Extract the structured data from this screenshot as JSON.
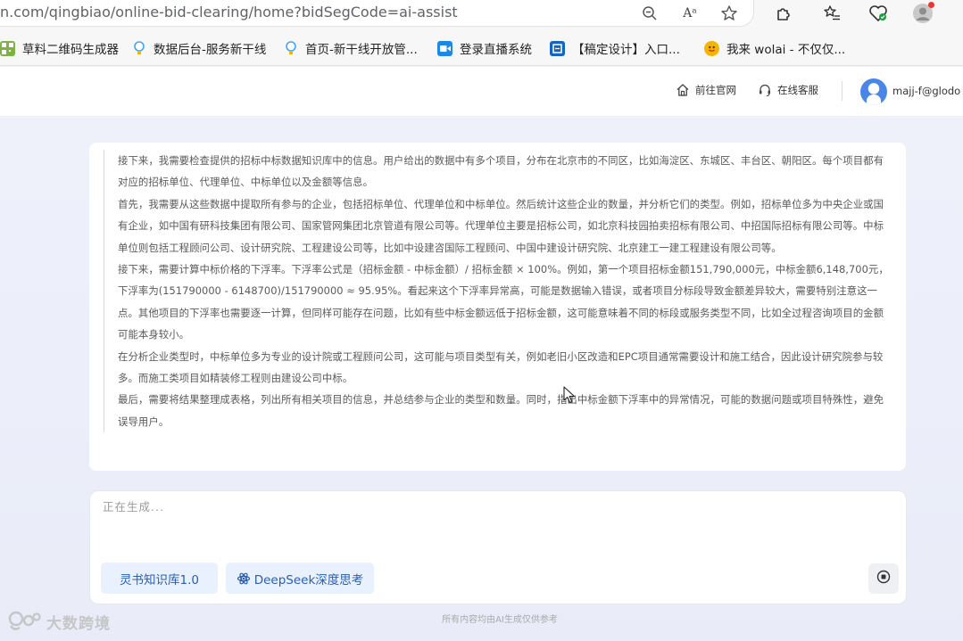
{
  "browser": {
    "url": "n.com/qingbiao/online-bid-clearing/home?bidSegCode=ai-assist",
    "reader_label": "Aᵃ",
    "bookmarks": [
      {
        "label": "草料二维码生成器",
        "icon": "qr-grid-icon",
        "color": "#7cb342"
      },
      {
        "label": "数据后台-服务新干线",
        "icon": "bulb-icon",
        "color": "#42a5f5"
      },
      {
        "label": "首页-新干线开放管...",
        "icon": "bulb-icon",
        "color": "#42a5f5"
      },
      {
        "label": "登录直播系统",
        "icon": "video-icon",
        "color": "#1e88e5"
      },
      {
        "label": "【稿定设计】入口...",
        "icon": "gaoding-icon",
        "color": "#1565c0"
      },
      {
        "label": "我来 wolai - 不仅仅...",
        "icon": "smiley-icon",
        "color": "#f4b400"
      }
    ]
  },
  "header": {
    "home_link": "前往官网",
    "service_link": "在线客服",
    "user": "majj-f@glodo"
  },
  "answer": {
    "paragraphs": [
      "接下来，我需要检查提供的招标中标数据知识库中的信息。用户给出的数据中有多个项目，分布在北京市的不同区，比如海淀区、东城区、丰台区、朝阳区。每个项目都有对应的招标单位、代理单位、中标单位以及金额等信息。",
      "首先，我需要从这些数据中提取所有参与的企业，包括招标单位、代理单位和中标单位。然后统计这些企业的数量，并分析它们的类型。例如，招标单位多为中央企业或国有企业，如中国有研科技集团有限公司、国家管网集团北京管道有限公司等。代理单位主要是招标公司，如北京科技园拍卖招标有限公司、中招国际招标有限公司等。中标单位则包括工程顾问公司、设计研究院、工程建设公司等，比如中设建咨国际工程顾问、中国中建设计研究院、北京建工一建工程建设有限公司等。",
      "接下来，需要计算中标价格的下浮率。下浮率公式是（招标金额 - 中标金额）/ 招标金额 × 100%。例如，第一个项目招标金额151,790,000元，中标金额6,148,700元，下浮率为(151790000 - 6148700)/151790000 ≈ 95.95%。看起来这个下浮率异常高，可能是数据输入错误，或者项目分标段导致金额差异较大，需要特别注意这一点。其他项目的下浮率也需要逐一计算，但同样可能存在问题，比如有些中标金额远低于招标金额，这可能意味着不同的标段或服务类型不同，比如全过程咨询项目的金额可能本身较小。",
      "在分析企业类型时，中标单位多为专业的设计院或工程顾问公司，这可能与项目类型有关，例如老旧小区改造和EPC项目通常需要设计和施工结合，因此设计研究院参与较多。而施工类项目如精装修工程则由建设公司中标。",
      "最后，需要将结果整理成表格，列出所有相关项目的信息，并总结参与企业的类型和数量。同时，指出中标金额下浮率中的异常情况，可能的数据问题或项目特殊性，避免误导用户。"
    ]
  },
  "input": {
    "placeholder": "正在生成...",
    "kb_button": "灵书知识库1.0",
    "deepseek_button": "DeepSeek深度思考"
  },
  "footer": {
    "disclaimer": "所有内容均由AI生成仅供参考",
    "watermark": "大数跨境"
  }
}
